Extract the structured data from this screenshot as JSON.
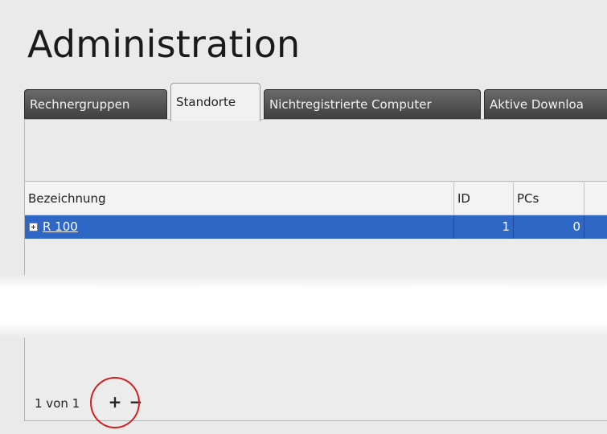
{
  "page": {
    "title": "Administration"
  },
  "tabs": [
    {
      "label": "Rechnergruppen",
      "active": false
    },
    {
      "label": "Standorte",
      "active": true
    },
    {
      "label": "Nichtregistrierte Computer",
      "active": false
    },
    {
      "label": "Aktive Downloa",
      "active": false
    }
  ],
  "grid": {
    "columns": [
      "Bezeichnung",
      "ID",
      "PCs"
    ],
    "rows": [
      {
        "name": "R 100",
        "id": "1",
        "pcs": "0",
        "selected": true
      }
    ]
  },
  "footer": {
    "pager_text": "1 von 1",
    "add_label": "+",
    "remove_label": "−"
  },
  "colors": {
    "selection": "#2f67c7",
    "highlight_ring": "#d41e1e"
  },
  "icons": {
    "expand": "plus-square-icon"
  }
}
